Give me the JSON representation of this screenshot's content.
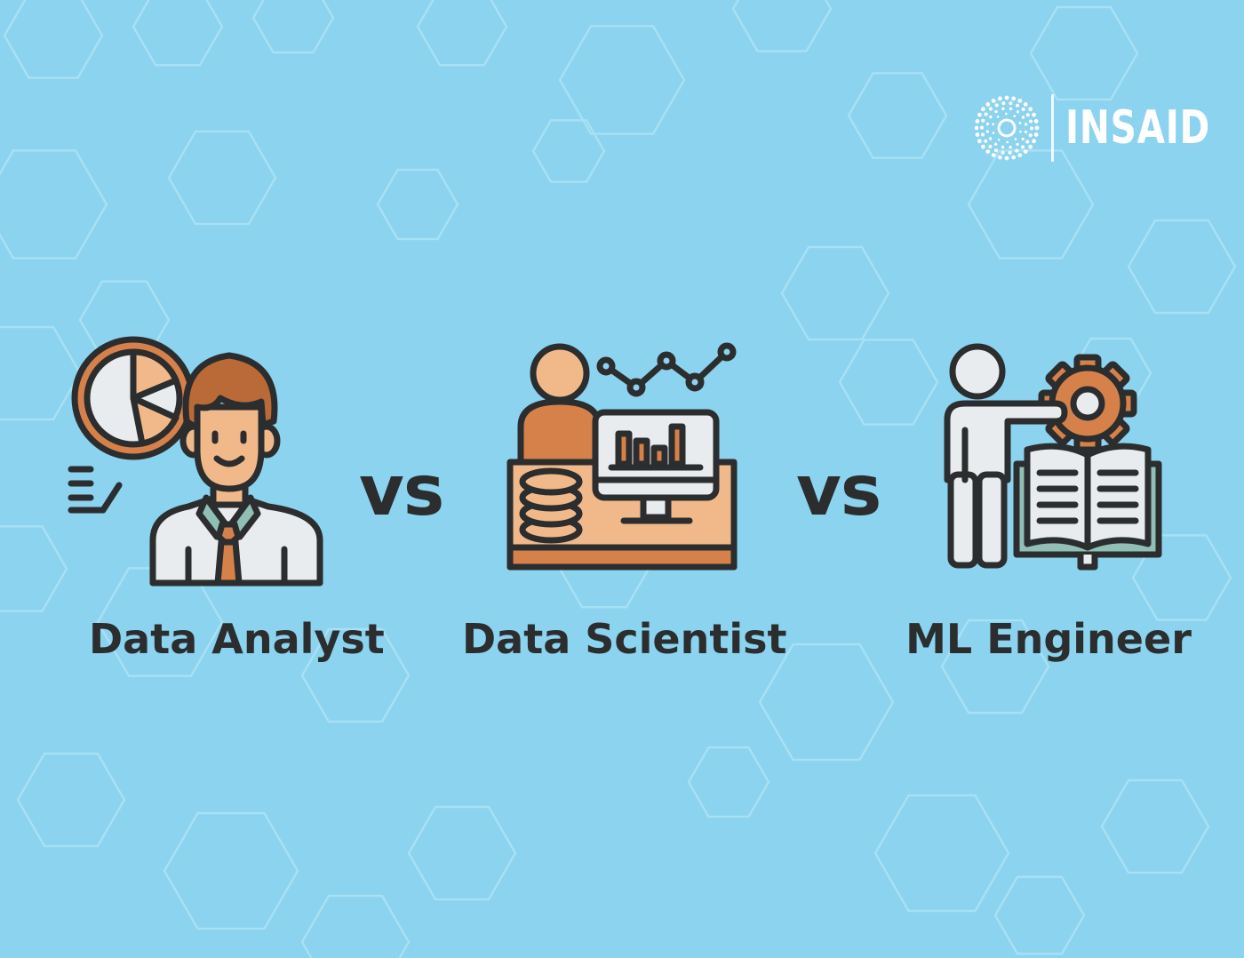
{
  "brand": {
    "name": "INSAID",
    "logo_icon": "dotted-ring-logo-icon"
  },
  "roles": [
    {
      "label": "Data Analyst",
      "icon": "data-analyst-icon"
    },
    {
      "label": "Data Scientist",
      "icon": "data-scientist-icon"
    },
    {
      "label": "ML Engineer",
      "icon": "ml-engineer-icon"
    }
  ],
  "separators": [
    "vs",
    "vs"
  ],
  "colors": {
    "background": "#8bd3ee",
    "outline": "#2b2d2e",
    "accent_orange": "#d6814a",
    "light_orange": "#f1b98a",
    "hair_brown": "#b96a36",
    "light_gray": "#e9ecee",
    "teal": "#8fbfb5",
    "white": "#ffffff"
  }
}
